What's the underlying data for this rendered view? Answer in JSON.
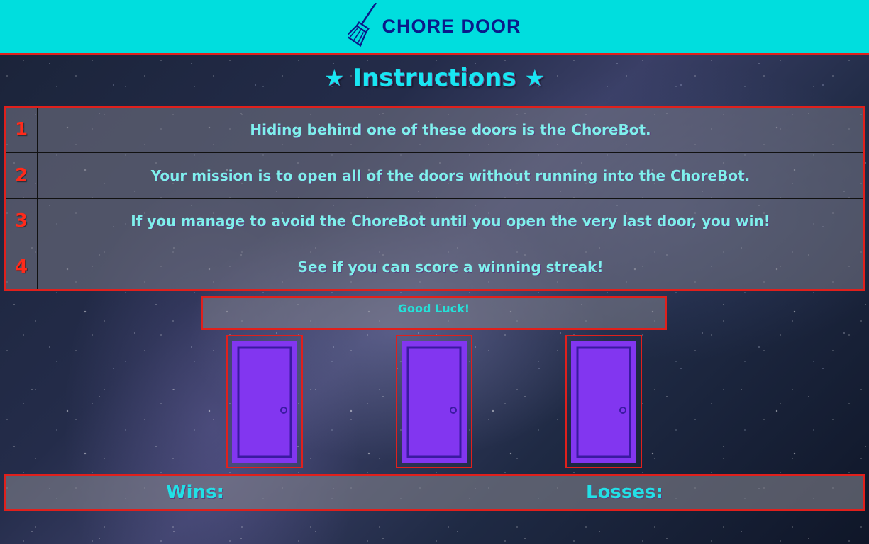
{
  "header": {
    "icon": "broom-icon",
    "title": "CHORE DOOR"
  },
  "instructions": {
    "title": "Instructions",
    "star_glyph": "★",
    "steps": [
      {
        "num": "1",
        "text": "Hiding behind one of these doors is the ChoreBot."
      },
      {
        "num": "2",
        "text": "Your mission is to open all of the doors without running into the ChoreBot."
      },
      {
        "num": "3",
        "text": "If you manage to avoid the ChoreBot until you open the very last door, you win!"
      },
      {
        "num": "4",
        "text": "See if you can score a winning streak!"
      }
    ]
  },
  "status": {
    "message": "Good Luck!"
  },
  "doors": [
    {
      "icon": "door-icon"
    },
    {
      "icon": "door-icon"
    },
    {
      "icon": "door-icon"
    }
  ],
  "score": {
    "wins_label": "Wins:",
    "losses_label": "Losses:"
  },
  "colors": {
    "header_bg": "#00dede",
    "accent_border": "#e0201c",
    "door_fill": "#8236f0",
    "door_outline": "#3a1aa0",
    "heading_text": "#18e6f2",
    "title_text": "#0a1a8a",
    "step_number": "#ff2a1a"
  }
}
